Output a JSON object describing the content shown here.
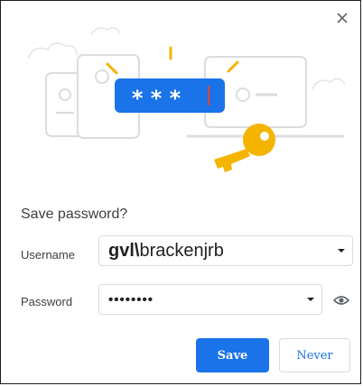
{
  "dialog": {
    "title": "Save password?",
    "username": {
      "label": "Username",
      "value_domain": "gvl\\",
      "value_user": "brackenjrb"
    },
    "password": {
      "label": "Password",
      "value": "••••••••"
    },
    "buttons": {
      "save": "Save",
      "never": "Never"
    },
    "illustration": {
      "masked_text": "* * *"
    },
    "icons": [
      "close-icon",
      "dropdown-arrow-icon",
      "show-password-eye-icon",
      "key-icon"
    ],
    "colors": {
      "primary": "#1a73e8",
      "key": "#f4b400",
      "illustration_gray": "#dadce0"
    }
  }
}
